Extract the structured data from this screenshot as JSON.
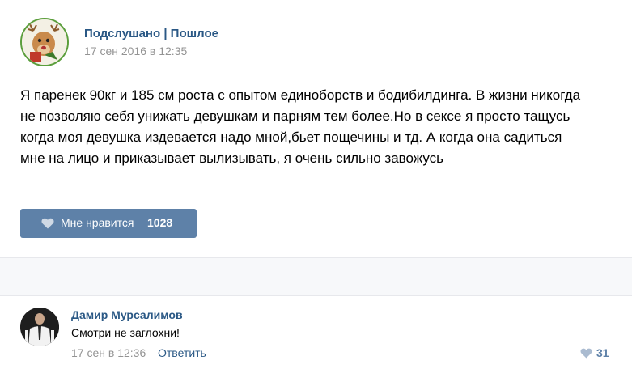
{
  "post": {
    "author": "Подслушано | Пошлое",
    "date": "17 сен 2016 в 12:35",
    "text": "Я паренек 90кг и 185 см роста с опытом единоборств и бодибилдинга. В жизни никогда не позволяю себя унижать девушкам и парням тем более.Но в сексе я просто тащусь когда моя девушка издевается надо мной,бьет пощечины и тд. А когда она садиться мне на лицо и приказывает вылизывать, я очень сильно завожусь",
    "like_label": "Мне нравится",
    "like_count": "1028"
  },
  "comment": {
    "author": "Дамир Мурсалимов",
    "text": "Смотри не заглохни!",
    "date": "17 сен в 12:36",
    "reply_label": "Ответить",
    "like_count": "31"
  },
  "colors": {
    "link": "#2a5885",
    "like_button": "#5e81a8",
    "muted": "#939393"
  },
  "icons": {
    "like": "heart-icon",
    "community_avatar": "deer-avatar",
    "user_avatar": "user-photo"
  }
}
